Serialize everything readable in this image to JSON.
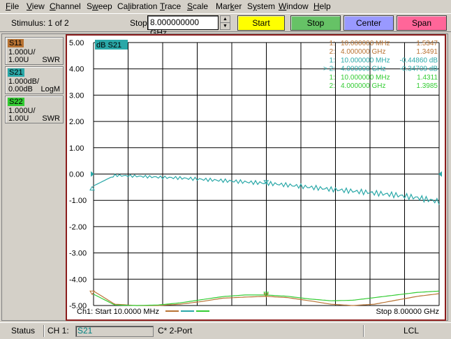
{
  "menu": [
    {
      "pre": "",
      "u": "F",
      "post": "ile"
    },
    {
      "pre": "",
      "u": "V",
      "post": "iew"
    },
    {
      "pre": "",
      "u": "C",
      "post": "hannel"
    },
    {
      "pre": "S",
      "u": "w",
      "post": "eep"
    },
    {
      "pre": "Ca",
      "u": "l",
      "post": "ibration"
    },
    {
      "pre": "",
      "u": "T",
      "post": "race"
    },
    {
      "pre": "",
      "u": "S",
      "post": "cale"
    },
    {
      "pre": "Mar",
      "u": "k",
      "post": "er"
    },
    {
      "pre": "S",
      "u": "y",
      "post": "stem"
    },
    {
      "pre": "",
      "u": "W",
      "post": "indow"
    },
    {
      "pre": "",
      "u": "H",
      "post": "elp"
    }
  ],
  "toolbar": {
    "stimulus": "Stimulus: 1 of 2",
    "stop_label": "Stop",
    "stop_value": "8.000000000 GHz",
    "buttons": [
      {
        "label": "Start",
        "color": "#ffff00"
      },
      {
        "label": "Stop",
        "color": "#66c266"
      },
      {
        "label": "Center",
        "color": "#9999ff"
      },
      {
        "label": "Span",
        "color": "#ff6699"
      }
    ]
  },
  "traces": [
    {
      "name": "S11",
      "scale": "1.000U/",
      "ref": "1.00U",
      "format": "SWR",
      "color": "#b87333"
    },
    {
      "name": "S21",
      "scale": "1.000dB/",
      "ref": "0.00dB",
      "format": "LogM",
      "color": "#2aa8a8"
    },
    {
      "name": "S22",
      "scale": "1.000U/",
      "ref": "1.00U",
      "format": "SWR",
      "color": "#33cc33"
    }
  ],
  "plot": {
    "trace_tag": "dB S21",
    "y_ticks": [
      "5.00",
      "4.00",
      "3.00",
      "2.00",
      "1.00",
      "0.00",
      "-1.00",
      "-2.00",
      "-3.00",
      "-4.00",
      "-5.00"
    ],
    "footer_start": "Ch1: Start  10.0000 MHz",
    "footer_stop": "Stop  8.00000 GHz",
    "colors": {
      "grid": "#000000",
      "s11": "#b87333",
      "s21": "#2aa8a8",
      "s22": "#33cc33"
    }
  },
  "markers": [
    {
      "id": "1:",
      "freq": "10.000000 MHz",
      "value": "1.5347",
      "color": "#b87333"
    },
    {
      "id": "2:",
      "freq": "4.000000 GHz",
      "value": "1.3491",
      "color": "#b87333"
    },
    {
      "id": "1:",
      "freq": "10.000000 MHz",
      "value": "-0.44860 dB",
      "color": "#2aa8a8"
    },
    {
      "id": "> 2:",
      "freq": "4.000000 GHz",
      "value": "-0.34709 dB",
      "color": "#2aa8a8"
    },
    {
      "id": "1:",
      "freq": "10.000000 MHz",
      "value": "1.4311",
      "color": "#33cc33"
    },
    {
      "id": "2:",
      "freq": "4.000000 GHz",
      "value": "1.3985",
      "color": "#33cc33"
    }
  ],
  "chart_data": {
    "type": "line",
    "x_range_ghz": [
      0.01,
      8.0
    ],
    "ylim": [
      -5,
      5
    ],
    "y_unit_per_div": 1,
    "grid": true,
    "series": [
      {
        "name": "S11",
        "color": "#b87333",
        "x": [
          0.01,
          0.5,
          1.0,
          1.5,
          2.0,
          2.5,
          3.0,
          3.5,
          4.0,
          4.5,
          5.0,
          5.5,
          6.0,
          6.5,
          7.0,
          7.5,
          8.0
        ],
        "y": [
          -4.45,
          -4.95,
          -5.0,
          -5.0,
          -4.95,
          -4.85,
          -4.72,
          -4.68,
          -4.65,
          -4.7,
          -4.82,
          -4.95,
          -5.0,
          -4.95,
          -4.8,
          -4.65,
          -4.55
        ]
      },
      {
        "name": "S21",
        "color": "#2aa8a8",
        "x": [
          0.01,
          0.5,
          1.0,
          1.5,
          2.0,
          2.5,
          3.0,
          3.5,
          4.0,
          4.5,
          5.0,
          5.5,
          6.0,
          6.5,
          7.0,
          7.5,
          8.0
        ],
        "y": [
          -0.45,
          -0.05,
          -0.08,
          -0.12,
          -0.15,
          -0.2,
          -0.25,
          -0.3,
          -0.35,
          -0.42,
          -0.5,
          -0.58,
          -0.65,
          -0.72,
          -0.8,
          -0.9,
          -1.05
        ]
      },
      {
        "name": "S22",
        "color": "#33cc33",
        "x": [
          0.01,
          0.5,
          1.0,
          1.5,
          2.0,
          2.5,
          3.0,
          3.5,
          4.0,
          4.5,
          5.0,
          5.5,
          6.0,
          6.5,
          7.0,
          7.5,
          8.0
        ],
        "y": [
          -4.57,
          -4.98,
          -5.0,
          -4.98,
          -4.9,
          -4.78,
          -4.66,
          -4.6,
          -4.6,
          -4.65,
          -4.75,
          -4.82,
          -4.8,
          -4.7,
          -4.6,
          -4.5,
          -4.45
        ]
      }
    ]
  },
  "status": {
    "label": "Status",
    "channel": "CH 1:",
    "trace": "S21",
    "cal": "C* 2-Port",
    "remote": "LCL"
  }
}
